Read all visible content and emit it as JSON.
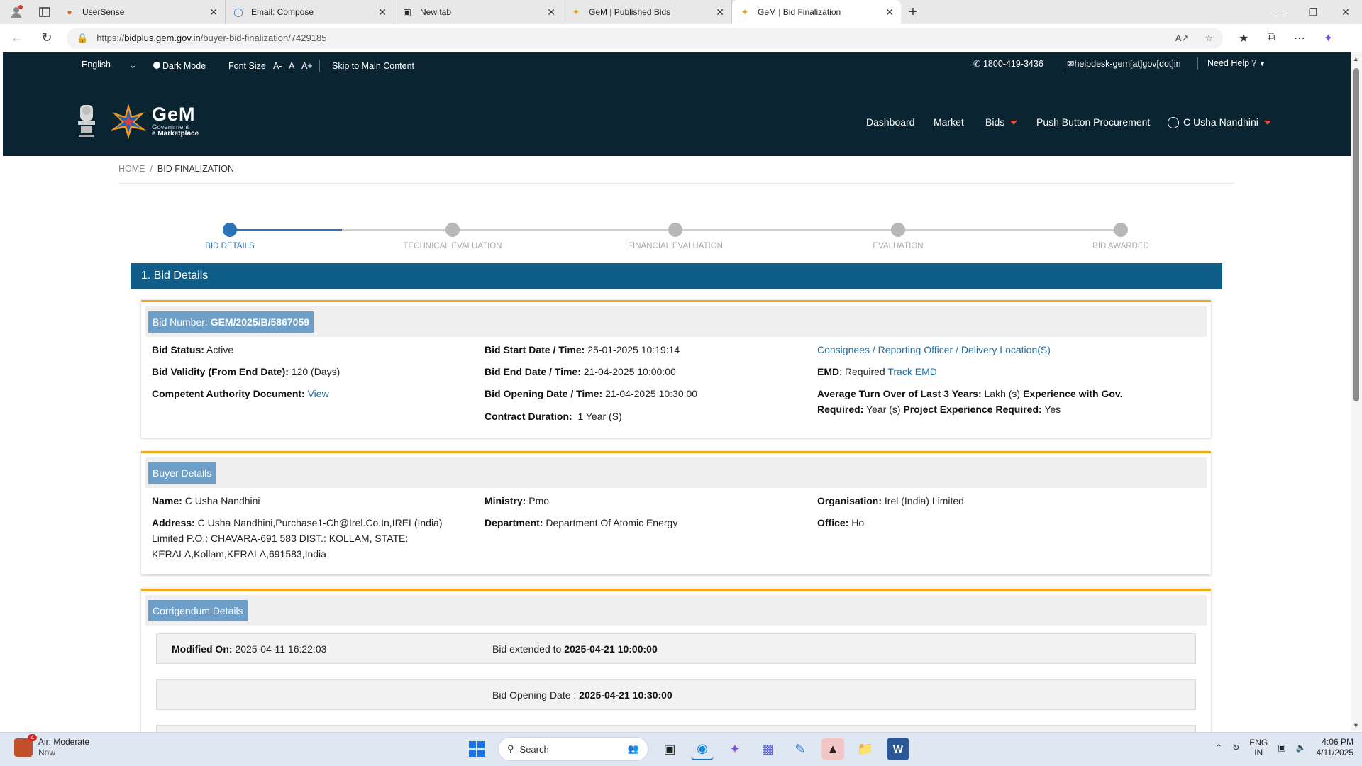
{
  "browser": {
    "tabs": [
      {
        "label": "UserSense",
        "icon": "usersense-icon",
        "active": false
      },
      {
        "label": "Email: Compose",
        "icon": "email-icon",
        "active": false
      },
      {
        "label": "New tab",
        "icon": "newtab-icon",
        "active": false
      },
      {
        "label": "GeM | Published Bids",
        "icon": "gem-icon",
        "active": false
      },
      {
        "label": "GeM | Bid Finalization",
        "icon": "gem-icon",
        "active": true
      }
    ],
    "url_prefix": "https://",
    "url_host": "bidplus.gem.gov.in",
    "url_path": "/buyer-bid-finalization/7429185"
  },
  "utility_bar": {
    "language": "English",
    "dark_mode": "Dark Mode",
    "font_size": "Font Size",
    "font_minus": "A-",
    "font_normal": "A",
    "font_plus": "A+",
    "skip": "Skip to Main Content",
    "phone": "1800-419-3436",
    "email": "helpdesk-gem[at]gov[dot]in",
    "help": "Need Help ?"
  },
  "brand": {
    "name": "GeM",
    "line1": "Government",
    "line2": "e Marketplace"
  },
  "nav": {
    "dashboard": "Dashboard",
    "market": "Market",
    "bids": "Bids",
    "push": "Push Button Procurement",
    "user": "C Usha Nandhini"
  },
  "breadcrumb": {
    "home": "HOME",
    "sep": "/",
    "current": "BID FINALIZATION"
  },
  "steps": [
    "BID DETAILS",
    "TECHNICAL EVALUATION",
    "FINANCIAL EVALUATION",
    "EVALUATION",
    "BID AWARDED"
  ],
  "section_title": "1. Bid Details",
  "bid": {
    "number_label": "Bid Number:",
    "number": "GEM/2025/B/5867059",
    "status_label": "Bid Status:",
    "status": "Active",
    "validity_label": "Bid Validity (From End Date):",
    "validity": "120 (Days)",
    "cad_label": "Competent Authority Document:",
    "cad_link": "View",
    "start_label": "Bid Start Date / Time:",
    "start": "25-01-2025 10:19:14",
    "end_label": "Bid End Date / Time:",
    "end": "21-04-2025 10:00:00",
    "opening_label": "Bid Opening Date / Time:",
    "opening": "21-04-2025 10:30:00",
    "duration_label": "Contract Duration:",
    "duration": "1 Year (S)",
    "consignees_link": "Consignees / Reporting Officer / Delivery Location(S)",
    "emd_label": "EMD",
    "emd_value": ": Required",
    "emd_link": "Track EMD",
    "turnover_label": "Average Turn Over of Last 3 Years:",
    "turnover": "Lakh (s)",
    "exp_label": "Experience with Gov. Required:",
    "exp": "Year (s)",
    "proj_label": "Project Experience Required:",
    "proj": "Yes"
  },
  "buyer": {
    "title": "Buyer Details",
    "name_label": "Name:",
    "name": "C Usha Nandhini",
    "address_label": "Address:",
    "address": "C Usha Nandhini,Purchase1-Ch@Irel.Co.In,IREL(India) Limited P.O.: CHAVARA-691 583 DIST.: KOLLAM, STATE: KERALA,Kollam,KERALA,691583,India",
    "ministry_label": "Ministry:",
    "ministry": "Pmo",
    "dept_label": "Department:",
    "dept": "Department Of Atomic Energy",
    "org_label": "Organisation:",
    "org": "Irel (India) Limited",
    "office_label": "Office:",
    "office": "Ho"
  },
  "corrigendum": {
    "title": "Corrigendum Details",
    "modified_label": "Modified On:",
    "modified": "2025-04-11 16:22:03",
    "extended_label": "Bid extended to",
    "extended": "2025-04-21 10:00:00",
    "opening_label": "Bid Opening Date :",
    "opening": "2025-04-21 10:30:00"
  },
  "taskbar": {
    "weather_title": "Air: Moderate",
    "weather_sub": "Now",
    "weather_badge": "4",
    "search": "Search",
    "lang1": "ENG",
    "lang2": "IN",
    "time": "4:06 PM",
    "date": "4/11/2025"
  },
  "colors": {
    "header_bg": "#0b2432",
    "section_bar": "#0f5e8a",
    "accent_orange": "#f4a61d",
    "link": "#1f6fa8",
    "step_active": "#2b73b8"
  }
}
